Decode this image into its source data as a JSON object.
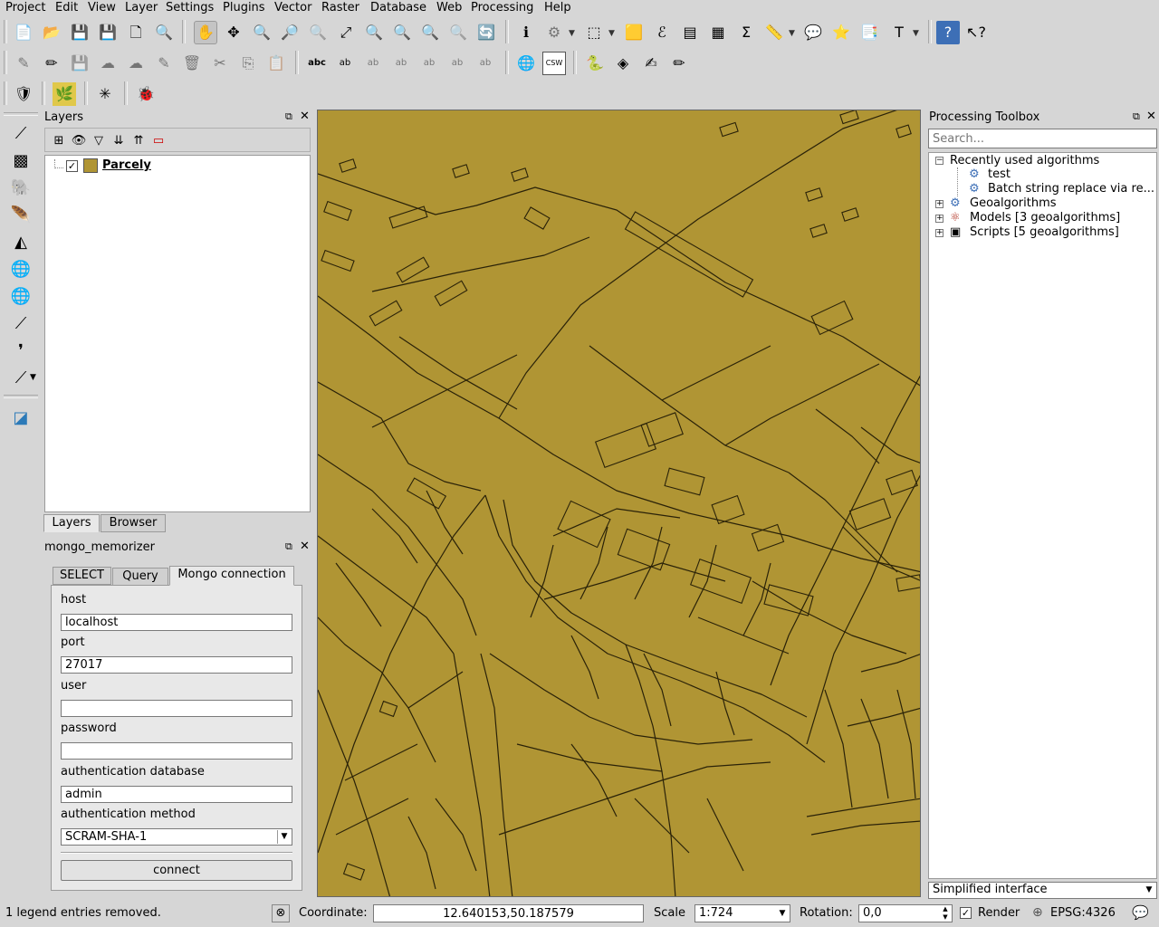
{
  "menubar": {
    "items": [
      "Project",
      "Edit",
      "View",
      "Layer",
      "Settings",
      "Plugins",
      "Vector",
      "Raster",
      "Database",
      "Web",
      "Processing",
      "Help"
    ]
  },
  "layers_panel": {
    "title": "Layers",
    "layer_name": "Parcely",
    "layer_checked": true,
    "layer_color": "#b09534",
    "tabs": [
      "Layers",
      "Browser"
    ]
  },
  "mongo_panel": {
    "title": "mongo_memorizer",
    "tabs": [
      "SELECT",
      "Query",
      "Mongo connection"
    ],
    "host_label": "host",
    "host_value": "localhost",
    "port_label": "port",
    "port_value": "27017",
    "user_label": "user",
    "user_value": "",
    "password_label": "password",
    "password_value": "",
    "authdb_label": "authentication database",
    "authdb_value": "admin",
    "authmethod_label": "authentication method",
    "authmethod_value": "SCRAM-SHA-1",
    "connect_label": "connect"
  },
  "processing": {
    "title": "Processing Toolbox",
    "search_placeholder": "Search...",
    "recent_label": "Recently used algorithms",
    "recent_items": [
      "test",
      "Batch string replace via re..."
    ],
    "groups": [
      "Geoalgorithms",
      "Models [3 geoalgorithms]",
      "Scripts [5 geoalgorithms]"
    ],
    "interface_select": "Simplified interface"
  },
  "statusbar": {
    "message": "1 legend entries removed.",
    "coordinate_label": "Coordinate:",
    "coordinate_value": "12.640153,50.187579",
    "scale_label": "Scale",
    "scale_value": "1:724",
    "rotation_label": "Rotation:",
    "rotation_value": "0,0",
    "render_label": "Render",
    "render_checked": true,
    "crs_label": "EPSG:4326"
  },
  "colors": {
    "map_fill": "#b09534",
    "chrome": "#d6d6d6"
  }
}
